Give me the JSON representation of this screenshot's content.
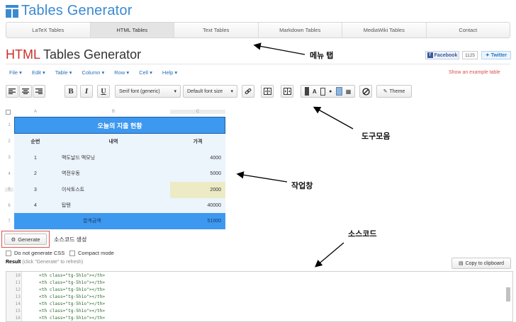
{
  "app": {
    "title": "Tables Generator"
  },
  "nav": {
    "tabs": [
      "LaTeX Tables",
      "HTML Tables",
      "Text Tables",
      "Markdown Tables",
      "MediaWiki Tables",
      "Contact"
    ],
    "active": 1
  },
  "page": {
    "title_colored": "HTML",
    "title_rest": " Tables Generator"
  },
  "social": {
    "facebook": "Facebook",
    "facebook_count": "1125",
    "twitter": "Twitter"
  },
  "menubar": {
    "items": [
      "File",
      "Edit",
      "Table",
      "Column",
      "Row",
      "Cell",
      "Help"
    ],
    "example": "Show an example table"
  },
  "toolbar": {
    "font": "Serif font (generic)",
    "font_size": "Default font size",
    "theme": "Theme"
  },
  "grid": {
    "columns": [
      "A",
      "B",
      "C"
    ],
    "row_numbers": [
      "1",
      "2",
      "3",
      "4",
      "5",
      "6",
      "7"
    ],
    "title": "오늘의 지출 현황",
    "headers": [
      "순번",
      "내역",
      "가격"
    ],
    "rows": [
      [
        "1",
        "맥도날드 맥모닝",
        "4000"
      ],
      [
        "2",
        "역전우동",
        "5000"
      ],
      [
        "3",
        "이삭토스트",
        "2000"
      ],
      [
        "4",
        "탑텐",
        "40000"
      ]
    ],
    "total_label": "합계금액",
    "total_value": "51000"
  },
  "generate": {
    "label": "Generate",
    "caption": "소스코드 생성"
  },
  "options": {
    "no_css": "Do not generate CSS",
    "compact": "Compact mode"
  },
  "result": {
    "label": "Result",
    "hint": " (click \"Generate\" to refresh)",
    "copy": "Copy to clipboard"
  },
  "code": {
    "line_numbers": [
      "10",
      "11",
      "12",
      "13",
      "14",
      "15",
      "16"
    ],
    "line_text": "<th class=\"tg-5h1o\"></th>"
  },
  "annotations": {
    "menu_tab": "메뉴 탭",
    "toolbar": "도구모음",
    "workspace": "작업창",
    "source": "소스코드"
  },
  "colors": {
    "accent": "#3d98ef",
    "link": "#2a6ebb",
    "red": "#c9302c",
    "highlight": "#ecebc6"
  }
}
